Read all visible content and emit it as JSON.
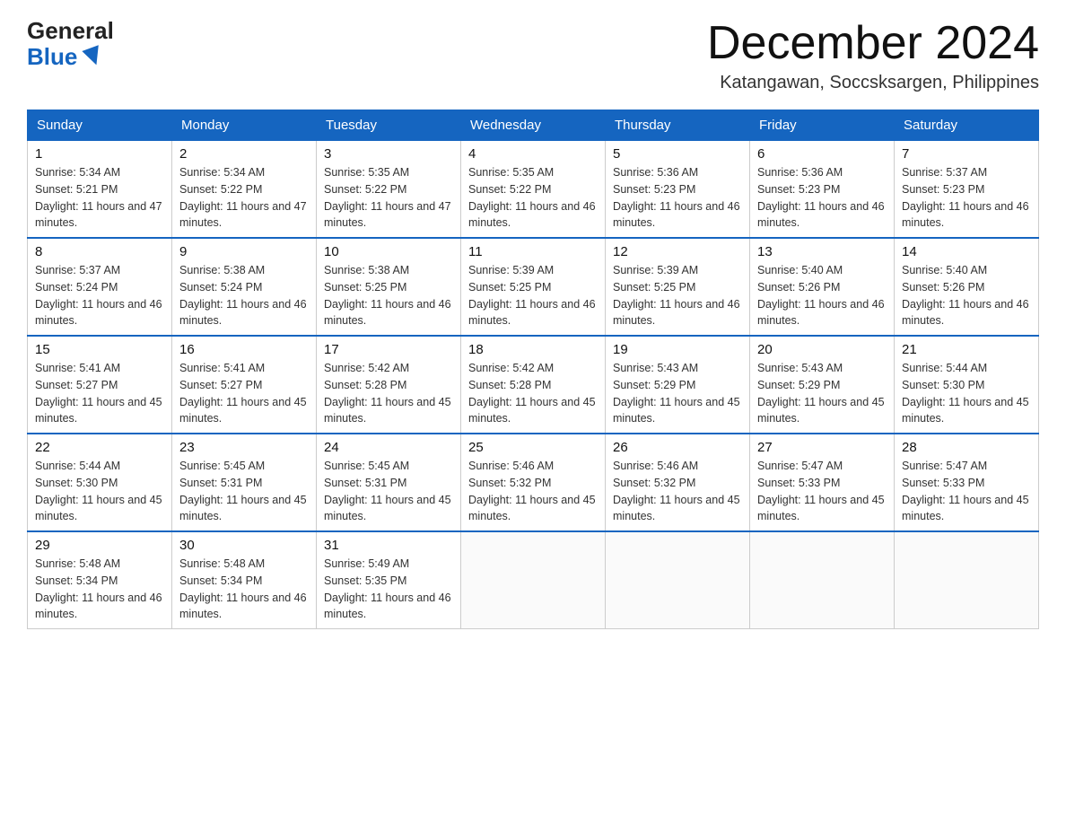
{
  "logo": {
    "general": "General",
    "blue": "Blue"
  },
  "title": "December 2024",
  "subtitle": "Katangawan, Soccsksargen, Philippines",
  "days_of_week": [
    "Sunday",
    "Monday",
    "Tuesday",
    "Wednesday",
    "Thursday",
    "Friday",
    "Saturday"
  ],
  "weeks": [
    [
      {
        "num": "1",
        "sunrise": "5:34 AM",
        "sunset": "5:21 PM",
        "daylight": "11 hours and 47 minutes."
      },
      {
        "num": "2",
        "sunrise": "5:34 AM",
        "sunset": "5:22 PM",
        "daylight": "11 hours and 47 minutes."
      },
      {
        "num": "3",
        "sunrise": "5:35 AM",
        "sunset": "5:22 PM",
        "daylight": "11 hours and 47 minutes."
      },
      {
        "num": "4",
        "sunrise": "5:35 AM",
        "sunset": "5:22 PM",
        "daylight": "11 hours and 46 minutes."
      },
      {
        "num": "5",
        "sunrise": "5:36 AM",
        "sunset": "5:23 PM",
        "daylight": "11 hours and 46 minutes."
      },
      {
        "num": "6",
        "sunrise": "5:36 AM",
        "sunset": "5:23 PM",
        "daylight": "11 hours and 46 minutes."
      },
      {
        "num": "7",
        "sunrise": "5:37 AM",
        "sunset": "5:23 PM",
        "daylight": "11 hours and 46 minutes."
      }
    ],
    [
      {
        "num": "8",
        "sunrise": "5:37 AM",
        "sunset": "5:24 PM",
        "daylight": "11 hours and 46 minutes."
      },
      {
        "num": "9",
        "sunrise": "5:38 AM",
        "sunset": "5:24 PM",
        "daylight": "11 hours and 46 minutes."
      },
      {
        "num": "10",
        "sunrise": "5:38 AM",
        "sunset": "5:25 PM",
        "daylight": "11 hours and 46 minutes."
      },
      {
        "num": "11",
        "sunrise": "5:39 AM",
        "sunset": "5:25 PM",
        "daylight": "11 hours and 46 minutes."
      },
      {
        "num": "12",
        "sunrise": "5:39 AM",
        "sunset": "5:25 PM",
        "daylight": "11 hours and 46 minutes."
      },
      {
        "num": "13",
        "sunrise": "5:40 AM",
        "sunset": "5:26 PM",
        "daylight": "11 hours and 46 minutes."
      },
      {
        "num": "14",
        "sunrise": "5:40 AM",
        "sunset": "5:26 PM",
        "daylight": "11 hours and 46 minutes."
      }
    ],
    [
      {
        "num": "15",
        "sunrise": "5:41 AM",
        "sunset": "5:27 PM",
        "daylight": "11 hours and 45 minutes."
      },
      {
        "num": "16",
        "sunrise": "5:41 AM",
        "sunset": "5:27 PM",
        "daylight": "11 hours and 45 minutes."
      },
      {
        "num": "17",
        "sunrise": "5:42 AM",
        "sunset": "5:28 PM",
        "daylight": "11 hours and 45 minutes."
      },
      {
        "num": "18",
        "sunrise": "5:42 AM",
        "sunset": "5:28 PM",
        "daylight": "11 hours and 45 minutes."
      },
      {
        "num": "19",
        "sunrise": "5:43 AM",
        "sunset": "5:29 PM",
        "daylight": "11 hours and 45 minutes."
      },
      {
        "num": "20",
        "sunrise": "5:43 AM",
        "sunset": "5:29 PM",
        "daylight": "11 hours and 45 minutes."
      },
      {
        "num": "21",
        "sunrise": "5:44 AM",
        "sunset": "5:30 PM",
        "daylight": "11 hours and 45 minutes."
      }
    ],
    [
      {
        "num": "22",
        "sunrise": "5:44 AM",
        "sunset": "5:30 PM",
        "daylight": "11 hours and 45 minutes."
      },
      {
        "num": "23",
        "sunrise": "5:45 AM",
        "sunset": "5:31 PM",
        "daylight": "11 hours and 45 minutes."
      },
      {
        "num": "24",
        "sunrise": "5:45 AM",
        "sunset": "5:31 PM",
        "daylight": "11 hours and 45 minutes."
      },
      {
        "num": "25",
        "sunrise": "5:46 AM",
        "sunset": "5:32 PM",
        "daylight": "11 hours and 45 minutes."
      },
      {
        "num": "26",
        "sunrise": "5:46 AM",
        "sunset": "5:32 PM",
        "daylight": "11 hours and 45 minutes."
      },
      {
        "num": "27",
        "sunrise": "5:47 AM",
        "sunset": "5:33 PM",
        "daylight": "11 hours and 45 minutes."
      },
      {
        "num": "28",
        "sunrise": "5:47 AM",
        "sunset": "5:33 PM",
        "daylight": "11 hours and 45 minutes."
      }
    ],
    [
      {
        "num": "29",
        "sunrise": "5:48 AM",
        "sunset": "5:34 PM",
        "daylight": "11 hours and 46 minutes."
      },
      {
        "num": "30",
        "sunrise": "5:48 AM",
        "sunset": "5:34 PM",
        "daylight": "11 hours and 46 minutes."
      },
      {
        "num": "31",
        "sunrise": "5:49 AM",
        "sunset": "5:35 PM",
        "daylight": "11 hours and 46 minutes."
      },
      null,
      null,
      null,
      null
    ]
  ]
}
